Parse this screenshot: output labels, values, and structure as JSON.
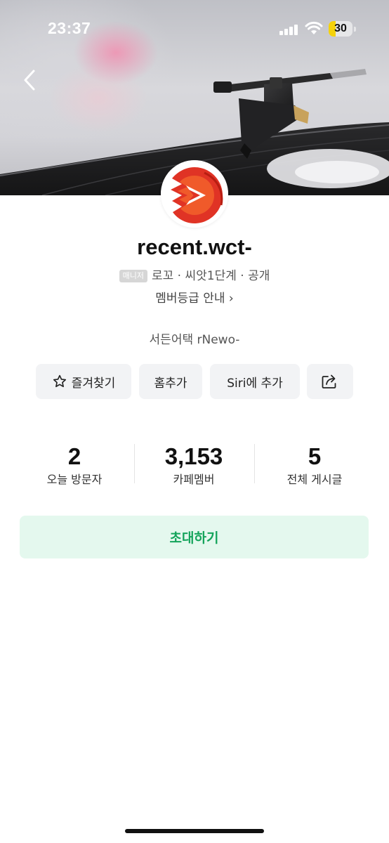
{
  "status_bar": {
    "time": "23:37",
    "battery_level": "30",
    "battery_fraction": 0.3,
    "battery_color": "#f5d20b"
  },
  "header": {
    "back_icon": "chevron-left-icon",
    "banner_image": "record-player-tonearm"
  },
  "cafe": {
    "name": "recent.wct-",
    "role_badge": "매니저",
    "meta": "로꼬 · 씨앗1단계 · 공개",
    "guide_link": "멤버등급 안내 ›",
    "description": "서든어택 rNewo-"
  },
  "actions": {
    "favorite_label": "즐겨찾기",
    "favorite_icon": "star-icon",
    "home_add_label": "홈추가",
    "siri_label": "Siri에 추가",
    "share_icon": "share-icon"
  },
  "stats": [
    {
      "value": "2",
      "label": "오늘 방문자"
    },
    {
      "value": "3,153",
      "label": "카페멤버"
    },
    {
      "value": "5",
      "label": "전체 게시글"
    }
  ],
  "invite": {
    "label": "초대하기",
    "accent": "#14a45b",
    "background": "#e4f8ee"
  }
}
